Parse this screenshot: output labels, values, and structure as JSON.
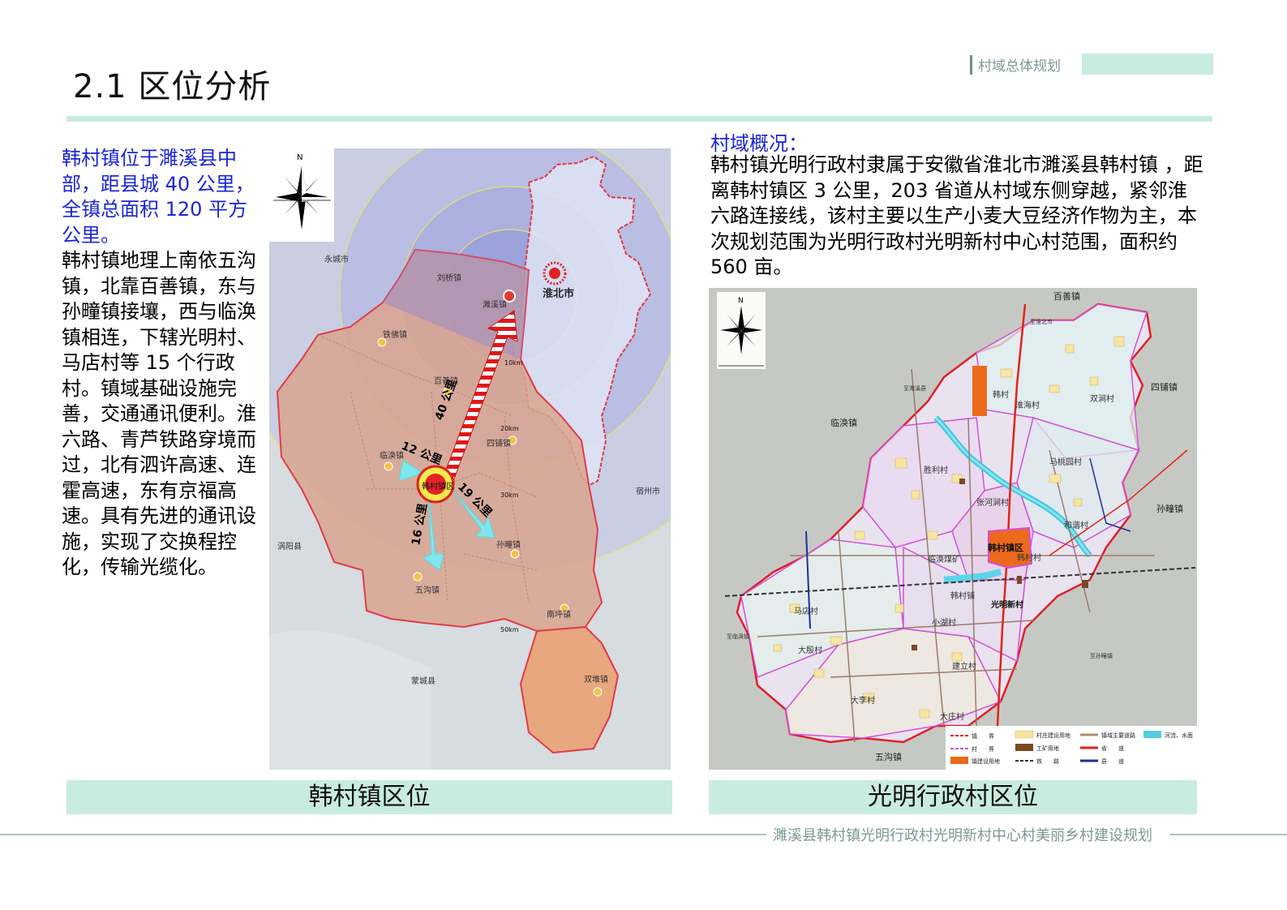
{
  "header": {
    "title": "2.1  区位分析",
    "section_tag": "村域总体规划"
  },
  "left_panel": {
    "intro_blue": "韩村镇位于濉溪县中部，距县城 40 公里，全镇总面积 120 平方公里。",
    "body": "韩村镇地理上南依五沟镇，北靠百善镇，东与孙疃镇接壤，西与临涣镇相连，下辖光明村、马店村等 15 个行政村。镇域基础设施完善，交通通讯便利。淮六路、青芦铁路穿境而过，北有泗许高速、连霍高速，东有京福高速。具有先进的通讯设施，实现了交换程控化，传输光缆化。"
  },
  "right_panel": {
    "heading": "村域概况：",
    "body": "韩村镇光明行政村隶属于安徽省淮北市濉溪县韩村镇 ，距离韩村镇区 3 公里，203 省道从村域东侧穿越，紧邻淮六路连接线，该村主要以生产小麦大豆经济作物为主，本次规划范围为光明行政村光明新村中心村范围，面积约 560 亩。"
  },
  "map1": {
    "compass_label": "N",
    "place_labels": {
      "yongcheng": "永城市",
      "huaibei": "淮北市",
      "suixi": "濉溪镇",
      "liuqiao": "刘桥镇",
      "tiefo": "铁佛镇",
      "baishan": "百善镇",
      "sipu": "四铺镇",
      "linhuan": "临涣镇",
      "hancun": "韩村镇区",
      "suzhou": "宿州市",
      "guoyang": "涡阳县",
      "wugou": "五沟镇",
      "suntuan": "孙疃镇",
      "nanping": "南坪镇",
      "mengcheng": "蒙城县",
      "shuangdui": "双堆镇"
    },
    "ring_labels": [
      "10km",
      "20km",
      "30km",
      "50km"
    ],
    "distances": {
      "north": "40 公里",
      "west": "12 公里",
      "south": "16 公里",
      "east": "19 公里"
    }
  },
  "map2": {
    "compass_label": "N",
    "town_labels": {
      "baishan": "百善镇",
      "sipu": "四铺镇",
      "linhuan": "临涣镇",
      "suntuan": "孙疃镇",
      "wugou": "五沟镇"
    },
    "village_labels": {
      "hancun": "韩村",
      "huaihai": "淮海村",
      "shuangjian": "双涧村",
      "shengli": "胜利村",
      "mataoyuan": "马桃园村",
      "zhanghejian": "张河涧村",
      "hexie": "和谐村",
      "town_area": "韩村镇区",
      "hancun2": "韩村村",
      "linhuan_mine": "临涣煤矿",
      "hancunpu": "韩村铺",
      "guangming": "光明新村",
      "madian": "马店村",
      "xiaohu": "小湖村",
      "dayin": "大殷村",
      "jianli": "建立村",
      "daqiao": "大李村",
      "dazhuang": "大庄村"
    },
    "road_labels": {
      "r1": "至淮北市",
      "r2": "至濉溪县",
      "r3": "至孙疃镇",
      "r4": "至临涣镇"
    },
    "legend": [
      {
        "label": "镇　　界",
        "color": "#e01e2a"
      },
      {
        "label": "村　　界",
        "color": "#d34fd8"
      },
      {
        "label": "镇建设用地",
        "color": "#ec6a1c"
      },
      {
        "label": "村庄建设用地",
        "color": "#f6e6a0"
      },
      {
        "label": "工矿用地",
        "color": "#7a4a24"
      },
      {
        "label": "铁　　路",
        "color": "#333333"
      },
      {
        "label": "镇域主要道路",
        "color": "#b48a72"
      },
      {
        "label": "省　　道",
        "color": "#e2231a"
      },
      {
        "label": "县　　道",
        "color": "#1d2f9c"
      },
      {
        "label": "河流、水面",
        "color": "#55cde0"
      }
    ]
  },
  "captions": {
    "left": "韩村镇区位",
    "right": "光明行政村区位"
  },
  "footer": {
    "text": "濉溪县韩村镇光明行政村光明新村中心村美丽乡村建设规划"
  }
}
